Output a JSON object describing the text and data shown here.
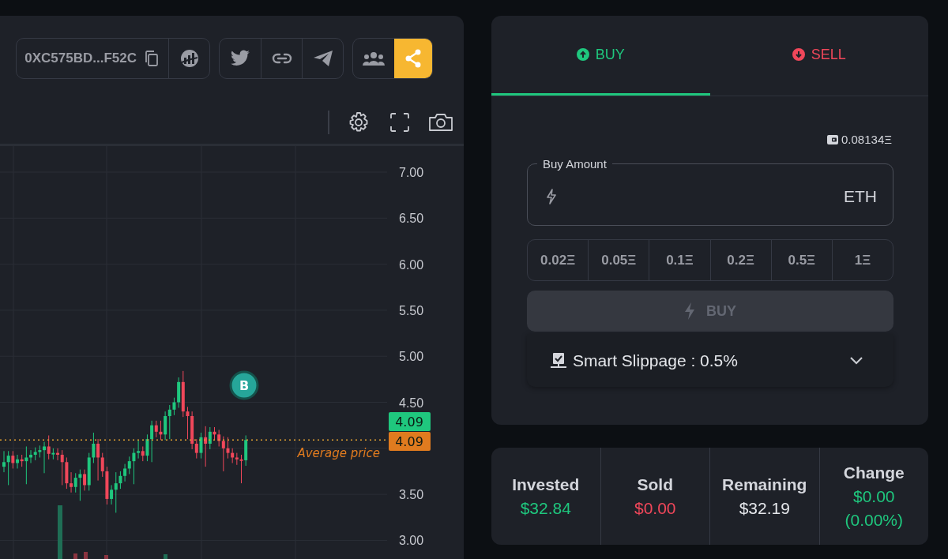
{
  "token_bar": {
    "address": "0XC575BD...F52C"
  },
  "chart": {
    "y_ticks": [
      "7.00",
      "6.50",
      "6.00",
      "5.50",
      "5.00",
      "4.50",
      "3.50",
      "3.00"
    ],
    "price_tags": [
      {
        "text": "4.09",
        "color": "#1fc77e"
      },
      {
        "text": "4.09",
        "color": "#e07b1f"
      }
    ],
    "average_label": "Average price",
    "marker": "B"
  },
  "trade_panel": {
    "tabs": [
      {
        "label": "BUY",
        "kind": "buy",
        "selected": true
      },
      {
        "label": "SELL",
        "kind": "sell",
        "selected": false
      }
    ],
    "balance": "0.08134Ξ",
    "amount_field": {
      "label": "Buy Amount",
      "unit": "ETH"
    },
    "presets": [
      "0.02Ξ",
      "0.05Ξ",
      "0.1Ξ",
      "0.2Ξ",
      "0.5Ξ",
      "1Ξ"
    ],
    "submit": {
      "label": "BUY",
      "disabled": true
    },
    "slippage": {
      "label": "Smart Slippage : 0.5%",
      "expanded": false
    }
  },
  "stats": [
    {
      "label": "Invested",
      "value": "$32.84",
      "color": "#1fc77e"
    },
    {
      "label": "Sold",
      "value": "$0.00",
      "color": "#f0475a"
    },
    {
      "label": "Remaining",
      "value": "$32.19",
      "color": "#e4e6ea"
    },
    {
      "label": "Change",
      "value": "$0.00",
      "detail": "(0.00%)",
      "color": "#1fc77e"
    }
  ]
}
